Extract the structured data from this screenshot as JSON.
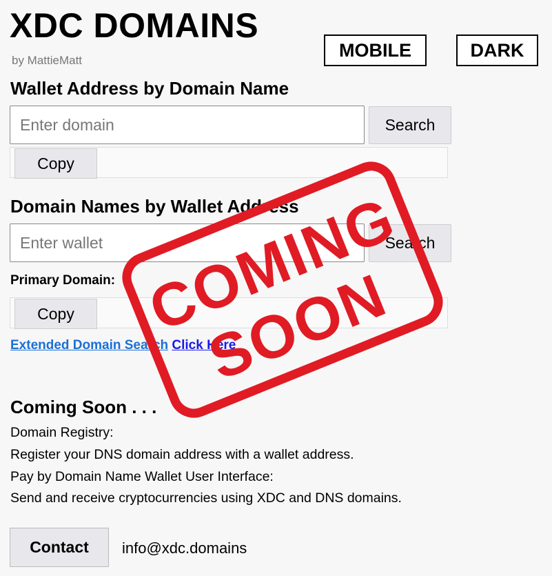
{
  "header": {
    "title": "XDC DOMAINS",
    "byline": "by MattieMatt",
    "mobile_label": "MOBILE",
    "dark_label": "DARK"
  },
  "wallet_by_domain": {
    "heading": "Wallet Address by Domain Name",
    "input_placeholder": "Enter domain",
    "search_label": "Search",
    "copy_label": "Copy"
  },
  "domains_by_wallet": {
    "heading": "Domain Names by Wallet Address",
    "input_placeholder": "Enter wallet",
    "search_label": "Search",
    "primary_label": "Primary Domain:",
    "copy_label": "Copy"
  },
  "extended": {
    "link_text": "Extended Domain Search",
    "click_text": "Click Here"
  },
  "coming_soon": {
    "heading": "Coming Soon . . .",
    "lines": [
      "Domain Registry:",
      "Register your DNS domain address with a wallet address.",
      "Pay by Domain Name Wallet User Interface:",
      "Send and receive cryptocurrencies using XDC and DNS domains."
    ]
  },
  "contact": {
    "button_label": "Contact",
    "email": "info@xdc.domains"
  },
  "stamp": {
    "line1": "COMING",
    "line2": "SOON",
    "color": "#e01b24"
  }
}
